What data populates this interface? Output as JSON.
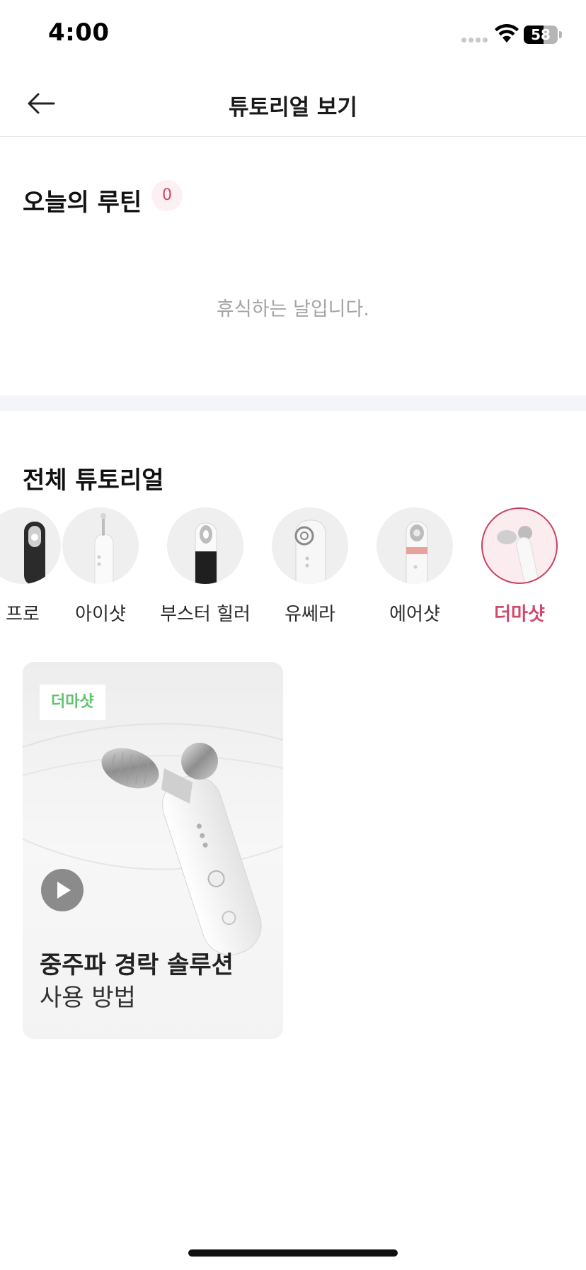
{
  "status_bar": {
    "time": "4:00",
    "battery_level": "58",
    "battery_fraction": 0.58,
    "icons": [
      "signal-icon",
      "wifi-icon",
      "battery-icon"
    ]
  },
  "header": {
    "back_icon": "arrow-left-icon",
    "title": "튜토리얼 보기"
  },
  "routine": {
    "title": "오늘의 루틴",
    "count": "0",
    "empty_message": "휴식하는 날입니다."
  },
  "all_tutorials": {
    "title": "전체 튜토리얼",
    "categories": [
      {
        "label": "프로",
        "selected": false
      },
      {
        "label": "아이샷",
        "selected": false
      },
      {
        "label": "부스터 힐러",
        "selected": false
      },
      {
        "label": "유쎄라",
        "selected": false
      },
      {
        "label": "에어샷",
        "selected": false
      },
      {
        "label": "더마샷",
        "selected": true
      }
    ]
  },
  "cards": [
    {
      "tag": "더마샷",
      "title": "중주파 경락 솔루션",
      "subtitle": "사용 방법",
      "play_icon": "play-icon"
    }
  ],
  "colors": {
    "accent": "#d2486b",
    "tag_green": "#5cc46b",
    "muted_text": "#a4a4a4",
    "band": "#f3f5f8"
  }
}
